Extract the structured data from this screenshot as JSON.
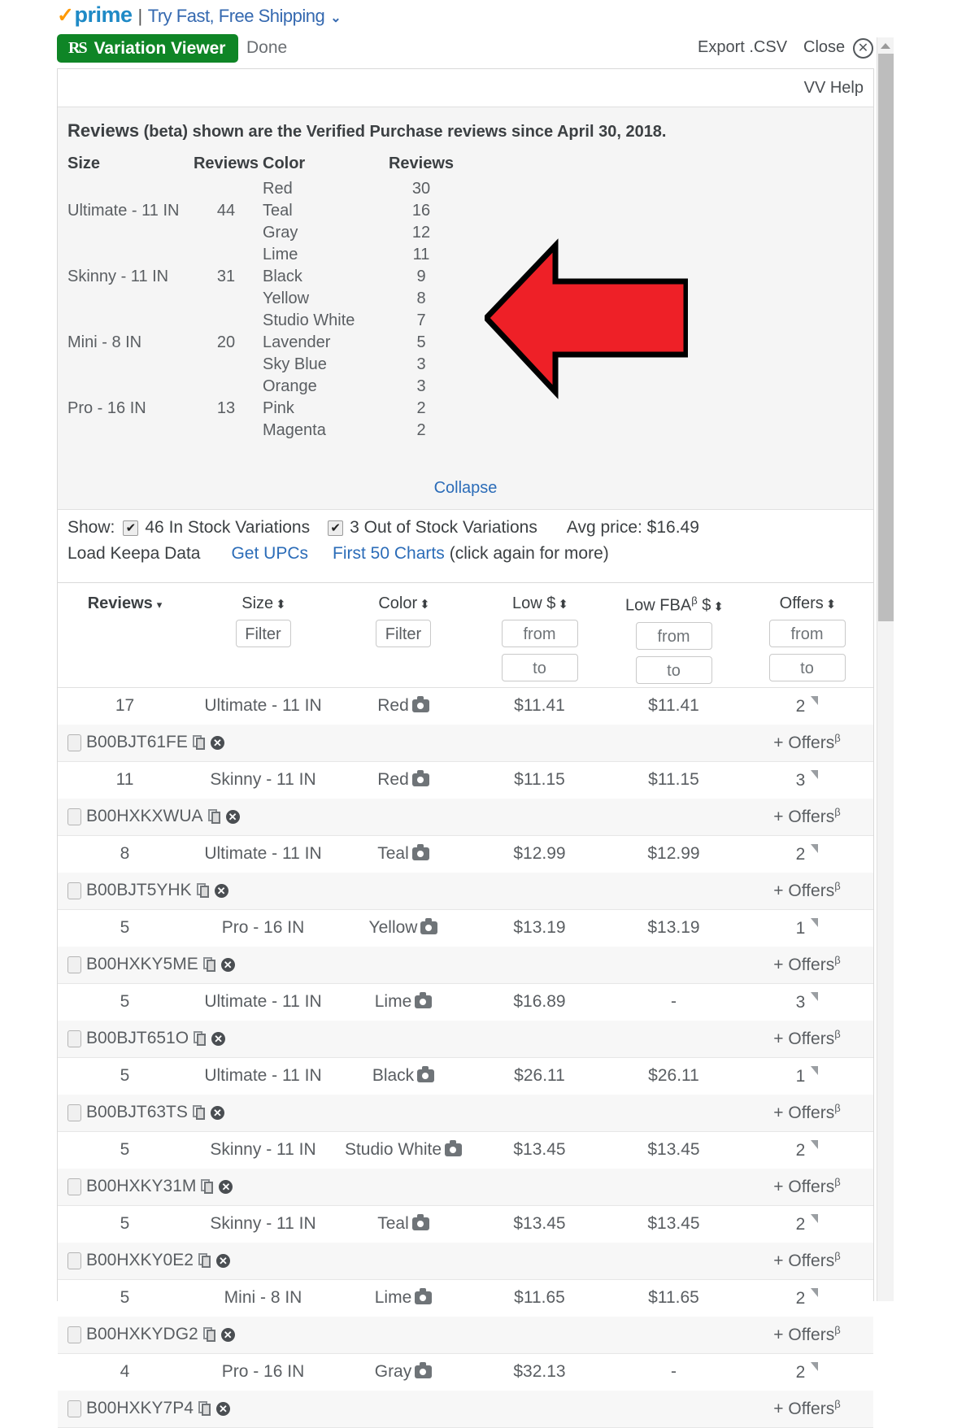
{
  "prime": {
    "check": "✓",
    "word": "prime",
    "pipe": "|",
    "link": "Try Fast, Free Shipping",
    "caret": "⌄"
  },
  "toolbar": {
    "rs_mark": "RS",
    "vv_button": "Variation Viewer",
    "done": "Done",
    "export_csv": "Export .CSV",
    "close": "Close",
    "close_glyph": "✕",
    "vv_help": "VV Help"
  },
  "reviews_panel": {
    "heading_strong": "Reviews",
    "heading_rest": " (beta) shown are the Verified Purchase reviews since April 30, 2018.",
    "size_header": "Size",
    "size_reviews_header": "Reviews",
    "color_header": "Color",
    "color_reviews_header": "Reviews",
    "sizes": [
      {
        "label": "Ultimate - 11 IN",
        "reviews": "44"
      },
      {
        "label": "Skinny - 11 IN",
        "reviews": "31"
      },
      {
        "label": "Mini - 8 IN",
        "reviews": "20"
      },
      {
        "label": "Pro - 16 IN",
        "reviews": "13"
      }
    ],
    "colors": [
      {
        "label": "Red",
        "reviews": "30"
      },
      {
        "label": "Teal",
        "reviews": "16"
      },
      {
        "label": "Gray",
        "reviews": "12"
      },
      {
        "label": "Lime",
        "reviews": "11"
      },
      {
        "label": "Black",
        "reviews": "9"
      },
      {
        "label": "Yellow",
        "reviews": "8"
      },
      {
        "label": "Studio White",
        "reviews": "7"
      },
      {
        "label": "Lavender",
        "reviews": "5"
      },
      {
        "label": "Sky Blue",
        "reviews": "3"
      },
      {
        "label": "Orange",
        "reviews": "3"
      },
      {
        "label": "Pink",
        "reviews": "2"
      },
      {
        "label": "Magenta",
        "reviews": "2"
      }
    ],
    "collapse": "Collapse"
  },
  "annotation": {
    "arrow_color": "#ee2027",
    "arrow_outline": "#000000",
    "arrow_direction": "left"
  },
  "controls": {
    "show_label": "Show:",
    "in_stock_checked": true,
    "in_stock_label": "46 In Stock Variations",
    "out_stock_checked": true,
    "out_stock_label": "3 Out of Stock Variations",
    "avg_price": "Avg price: $16.49",
    "load_keepa": "Load Keepa Data",
    "get_upcs": "Get UPCs",
    "first_50_charts": "First 50 Charts",
    "charts_hint": "(click again for more)",
    "check_glyph": "✔"
  },
  "table": {
    "columns": {
      "reviews": "Reviews",
      "size": "Size",
      "color": "Color",
      "low": "Low $",
      "low_fba": "Low FBA",
      "low_fba_sup": "β",
      "low_fba_tail": " $",
      "offers": "Offers"
    },
    "filters": {
      "size_filter": "Filter",
      "color_filter": "Filter",
      "from": "from",
      "to": "to"
    },
    "offers_link": "+ Offers",
    "offers_link_sup": "β",
    "rows": [
      {
        "reviews": "17",
        "size": "Ultimate - 11 IN",
        "color": "Red",
        "low": "$11.41",
        "low_fba": "$11.41",
        "offers": "2",
        "asin": "B00BJT61FE"
      },
      {
        "reviews": "11",
        "size": "Skinny - 11 IN",
        "color": "Red",
        "low": "$11.15",
        "low_fba": "$11.15",
        "offers": "3",
        "asin": "B00HXKXWUA"
      },
      {
        "reviews": "8",
        "size": "Ultimate - 11 IN",
        "color": "Teal",
        "low": "$12.99",
        "low_fba": "$12.99",
        "offers": "2",
        "asin": "B00BJT5YHK"
      },
      {
        "reviews": "5",
        "size": "Pro - 16 IN",
        "color": "Yellow",
        "low": "$13.19",
        "low_fba": "$13.19",
        "offers": "1",
        "asin": "B00HXKY5ME"
      },
      {
        "reviews": "5",
        "size": "Ultimate - 11 IN",
        "color": "Lime",
        "low": "$16.89",
        "low_fba": "-",
        "offers": "3",
        "asin": "B00BJT651O"
      },
      {
        "reviews": "5",
        "size": "Ultimate - 11 IN",
        "color": "Black",
        "low": "$26.11",
        "low_fba": "$26.11",
        "offers": "1",
        "asin": "B00BJT63TS"
      },
      {
        "reviews": "5",
        "size": "Skinny - 11 IN",
        "color": "Studio White",
        "low": "$13.45",
        "low_fba": "$13.45",
        "offers": "2",
        "asin": "B00HXKY31M"
      },
      {
        "reviews": "5",
        "size": "Skinny - 11 IN",
        "color": "Teal",
        "low": "$13.45",
        "low_fba": "$13.45",
        "offers": "2",
        "asin": "B00HXKY0E2"
      },
      {
        "reviews": "5",
        "size": "Mini - 8 IN",
        "color": "Lime",
        "low": "$11.65",
        "low_fba": "$11.65",
        "offers": "2",
        "asin": "B00HXKYDG2"
      },
      {
        "reviews": "4",
        "size": "Pro - 16 IN",
        "color": "Gray",
        "low": "$32.13",
        "low_fba": "-",
        "offers": "2",
        "asin": "B00HXKY7P4"
      }
    ]
  }
}
